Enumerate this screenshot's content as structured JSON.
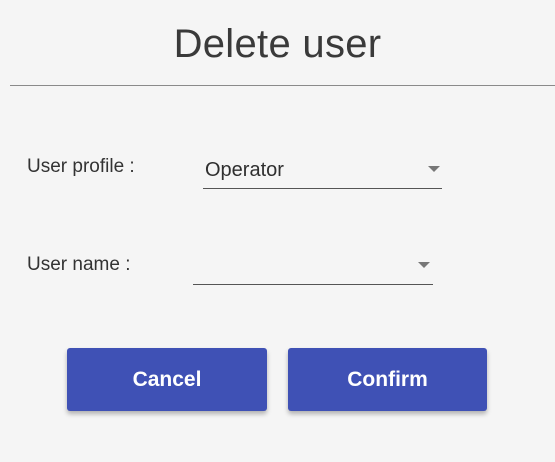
{
  "dialog": {
    "title": "Delete user"
  },
  "form": {
    "profile": {
      "label": "User profile :",
      "value": "Operator"
    },
    "username": {
      "label": "User name :",
      "value": ""
    }
  },
  "actions": {
    "cancel_label": "Cancel",
    "confirm_label": "Confirm"
  },
  "colors": {
    "primary": "#3f51b5",
    "background": "#f5f5f5",
    "text": "#333333"
  },
  "icons": {
    "dropdown": "caret-down-icon"
  }
}
